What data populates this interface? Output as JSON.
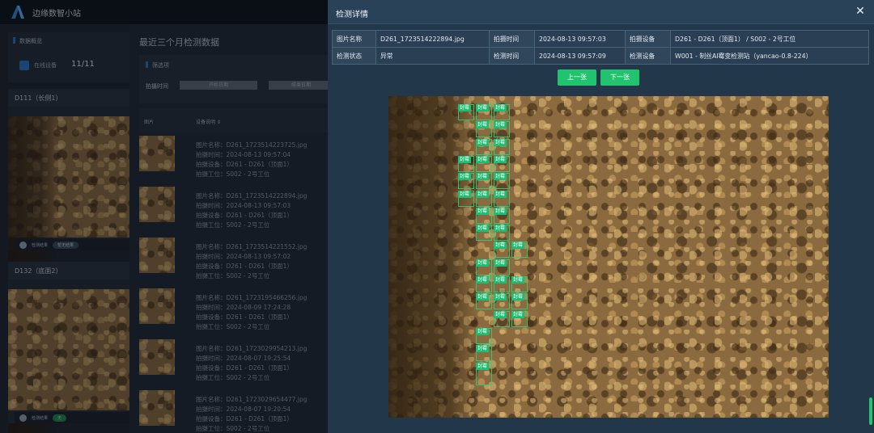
{
  "app": {
    "title": "边缘数智小站"
  },
  "overview": {
    "title": "数据概览",
    "online_label": "在线设备",
    "online_count": "11/11"
  },
  "cameras": [
    {
      "name": "D111（长侧1）",
      "status_text": "检测结果",
      "status_pill": "暂无结果",
      "pill_color": "#3a4a5c"
    },
    {
      "name": "D132（底面2）",
      "status_text": "检测结果",
      "status_pill": "无",
      "pill_color": "#1e8a4c"
    }
  ],
  "main": {
    "title": "最近三个月检测数据",
    "filter": {
      "title": "筛选项",
      "time_label": "拍摄时间",
      "start_placeholder": "开始日期",
      "end_placeholder": "结束日期"
    },
    "table": {
      "col_image": "图片",
      "col_desc": "设备说明 ⇕",
      "rows": [
        {
          "name": "图片名称：D261_1723514223725.jpg",
          "time": "拍摄时间：2024-08-13 09:57:04",
          "device": "拍摄设备：D261 - D261（顶面1）",
          "station": "拍摄工位：S002 - 2号工位"
        },
        {
          "name": "图片名称：D261_1723514222894.jpg",
          "time": "拍摄时间：2024-08-13 09:57:03",
          "device": "拍摄设备：D261 - D261（顶面1）",
          "station": "拍摄工位：S002 - 2号工位"
        },
        {
          "name": "图片名称：D261_1723514221552.jpg",
          "time": "拍摄时间：2024-08-13 09:57:02",
          "device": "拍摄设备：D261 - D261（顶面1）",
          "station": "拍摄工位：S002 - 2号工位"
        },
        {
          "name": "图片名称：D261_1723195466256.jpg",
          "time": "拍摄时间：2024-08-09 17:24:28",
          "device": "拍摄设备：D261 - D261（顶面1）",
          "station": "拍摄工位：S002 - 2号工位"
        },
        {
          "name": "图片名称：D261_1723029954213.jpg",
          "time": "拍摄时间：2024-08-07 19:25:54",
          "device": "拍摄设备：D261 - D261（顶面1）",
          "station": "拍摄工位：S002 - 2号工位"
        },
        {
          "name": "图片名称：D261_1723029654477.jpg",
          "time": "拍摄时间：2024-08-07 19:20:54",
          "device": "拍摄设备：D261 - D261（顶面1）",
          "station": "拍摄工位：S002 - 2号工位"
        }
      ]
    }
  },
  "modal": {
    "title": "检测详情",
    "close_icon": "close-icon",
    "info": {
      "image_name_label": "图片名称",
      "image_name": "D261_1723514222894.jpg",
      "shoot_time_label": "拍摄时间",
      "shoot_time": "2024-08-13 09:57:03",
      "shoot_device_label": "拍摄设备",
      "shoot_device": "D261 - D261（顶面1） / S002 - 2号工位",
      "detect_status_label": "检测状态",
      "detect_status": "异常",
      "detect_time_label": "检测时间",
      "detect_time": "2024-08-13 09:57:09",
      "detect_device_label": "检测设备",
      "detect_device": "W001 - 制丝AI霉变检测站（yancao-0.8-224）"
    },
    "prev_label": "上一张",
    "next_label": "下一张",
    "detection_label": "封霉",
    "detection_count": 44,
    "accent_color": "#22c36e"
  }
}
